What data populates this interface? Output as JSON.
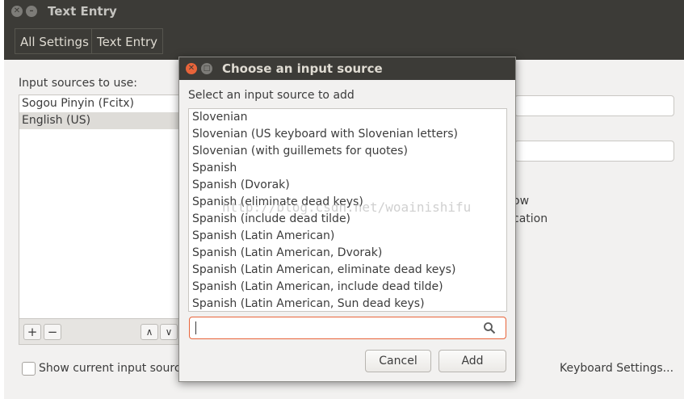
{
  "window": {
    "title": "Text Entry"
  },
  "breadcrumb": {
    "all_settings": "All Settings",
    "text_entry": "Text Entry"
  },
  "main": {
    "sources_label": "Input sources to use:",
    "sources": [
      "Sogou Pinyin (Fcitx)",
      "English (US)"
    ],
    "add_glyph": "+",
    "remove_glyph": "−",
    "up_glyph": "∧",
    "down_glyph": "∨",
    "show_current_label": "Show current input source",
    "partial_text_1": "ow",
    "partial_text_2": "cation",
    "keyboard_settings": "Keyboard Settings..."
  },
  "dialog": {
    "title": "Choose an input source",
    "prompt": "Select an input source to add",
    "options": [
      "Slovenian",
      "Slovenian (US keyboard with Slovenian letters)",
      "Slovenian (with guillemets for quotes)",
      "Spanish",
      "Spanish (Dvorak)",
      "Spanish (eliminate dead keys)",
      "Spanish (include dead tilde)",
      "Spanish (Latin American)",
      "Spanish (Latin American, Dvorak)",
      "Spanish (Latin American, eliminate dead keys)",
      "Spanish (Latin American, include dead tilde)",
      "Spanish (Latin American, Sun dead keys)"
    ],
    "search_value": "",
    "cancel_label": "Cancel",
    "add_label": "Add"
  },
  "watermark": "http://blog.csdn.net/woainishifu",
  "colors": {
    "titlebar": "#3c3b37",
    "accent": "#e8643a",
    "background": "#f2f1f0"
  }
}
